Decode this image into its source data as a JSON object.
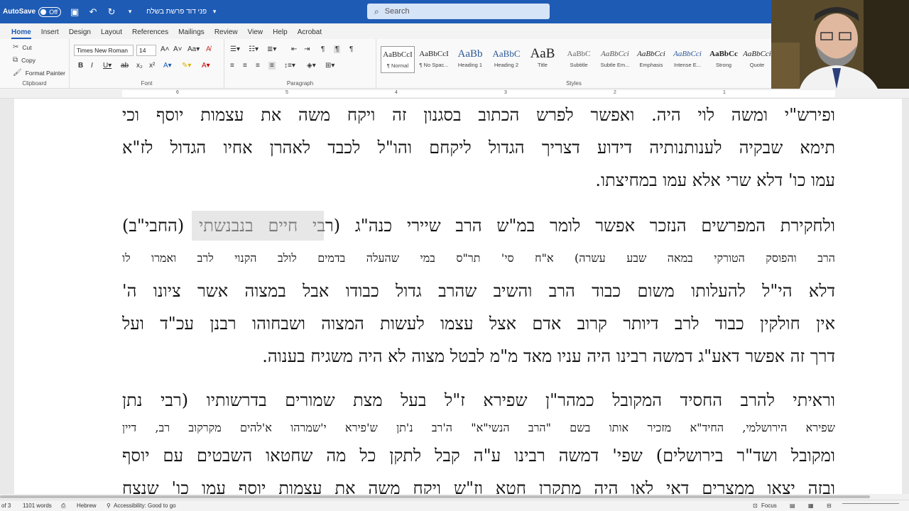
{
  "titlebar": {
    "autosave_label": "AutoSave",
    "autosave_state": "Off",
    "doc_name": "פני דוד פרשת בשלח",
    "search_placeholder": "Search"
  },
  "ribbon_tabs": [
    "Home",
    "Insert",
    "Design",
    "Layout",
    "References",
    "Mailings",
    "Review",
    "View",
    "Help",
    "Acrobat"
  ],
  "clipboard": {
    "cut": "Cut",
    "copy": "Copy",
    "format_painter": "Format Painter",
    "label": "Clipboard"
  },
  "font": {
    "name": "Times New Roman",
    "size": "14",
    "label": "Font"
  },
  "paragraph": {
    "label": "Paragraph"
  },
  "styles": {
    "label": "Styles",
    "items": [
      {
        "preview": "AaBbCcI",
        "name": "¶ Normal"
      },
      {
        "preview": "AaBbCcI",
        "name": "¶ No Spac..."
      },
      {
        "preview": "AaBb",
        "name": "Heading 1"
      },
      {
        "preview": "AaBbC",
        "name": "Heading 2"
      },
      {
        "preview": "AaB",
        "name": "Title"
      },
      {
        "preview": "AaBbC",
        "name": "Subtitle"
      },
      {
        "preview": "AaBbCci",
        "name": "Subtle Em..."
      },
      {
        "preview": "AaBbCci",
        "name": "Emphasis"
      },
      {
        "preview": "AaBbCci",
        "name": "Intense E..."
      },
      {
        "preview": "AaBbCc",
        "name": "Strong"
      },
      {
        "preview": "AaBbCci",
        "name": "Quote"
      }
    ]
  },
  "document": {
    "lines": [
      "ופירש\"י ומשה לוי היה. ואפשר לפרש הכתוב בסגנון זה ויקח משה את עצמות יוסף וכי",
      "תימא שבקיה לענותנותיה דידוע דצריך הגדול ליקחם והו\"ל לכבד לאהרן אחיו הגדול לז\"א",
      "עמו כו' דלא שרי אלא עמו במחיצתו.",
      "ולחקירת המפרשים הנזכר אפשר לומר במ\"ש הרב שיירי כנה\"ג (רבי חיים בנבנשתי (החבי\"ב)",
      "הרב והפוסק הטורקי במאה שבע עשרה) א\"ח סי' תר\"ס במי שהעלה בדמים לולב הקנוי לרב ואמרו לו",
      "דלא הי\"ל להעלותו משום כבוד הרב והשיב שהרב גדול כבודו אבל במצוה אשר ציונו ה'",
      "אין חולקין כבוד לרב דיותר קרוב אדם אצל עצמו לעשות המצוה ושבחוהו רבנן עכ\"ד ועל",
      "דרך זה אפשר דאע\"ג דמשה רבינו היה עניו מאד מ\"מ לבטל מצוה לא היה משגיח בענוה.",
      "וראיתי להרב החסיד המקובל כמהר\"ן שפירא ז\"ל בעל מצת שמורים בדרשותיו (רבי נתן",
      "שפירא הירושלמי, החיד\"א מזכיר אותו בשם \"הרב הנשי\"א\" ה'רב נ'תן ש'פירא י'שמרהו א'להים מקרקוב רב, דיין",
      "ומקובל ושד\"ר בירושלים) שפי' דמשה רבינו ע\"ה קבל לתקן כל מה שחטאו השבטים עם יוסף",
      "ובזה יצאו ממצרים דאי לאו היה מתקרן חטא וז\"ש ויקח משה את עצמות יוסף עמו כו' שנצח"
    ],
    "highlighted": "רבי חיים בנבנשתי"
  },
  "statusbar": {
    "page": "of 3",
    "words": "1101 words",
    "language": "Hebrew",
    "accessibility": "Accessibility: Good to go",
    "focus": "Focus"
  },
  "colors": {
    "accent": "#1e5bb5",
    "highlight": "#d4d4d4"
  }
}
